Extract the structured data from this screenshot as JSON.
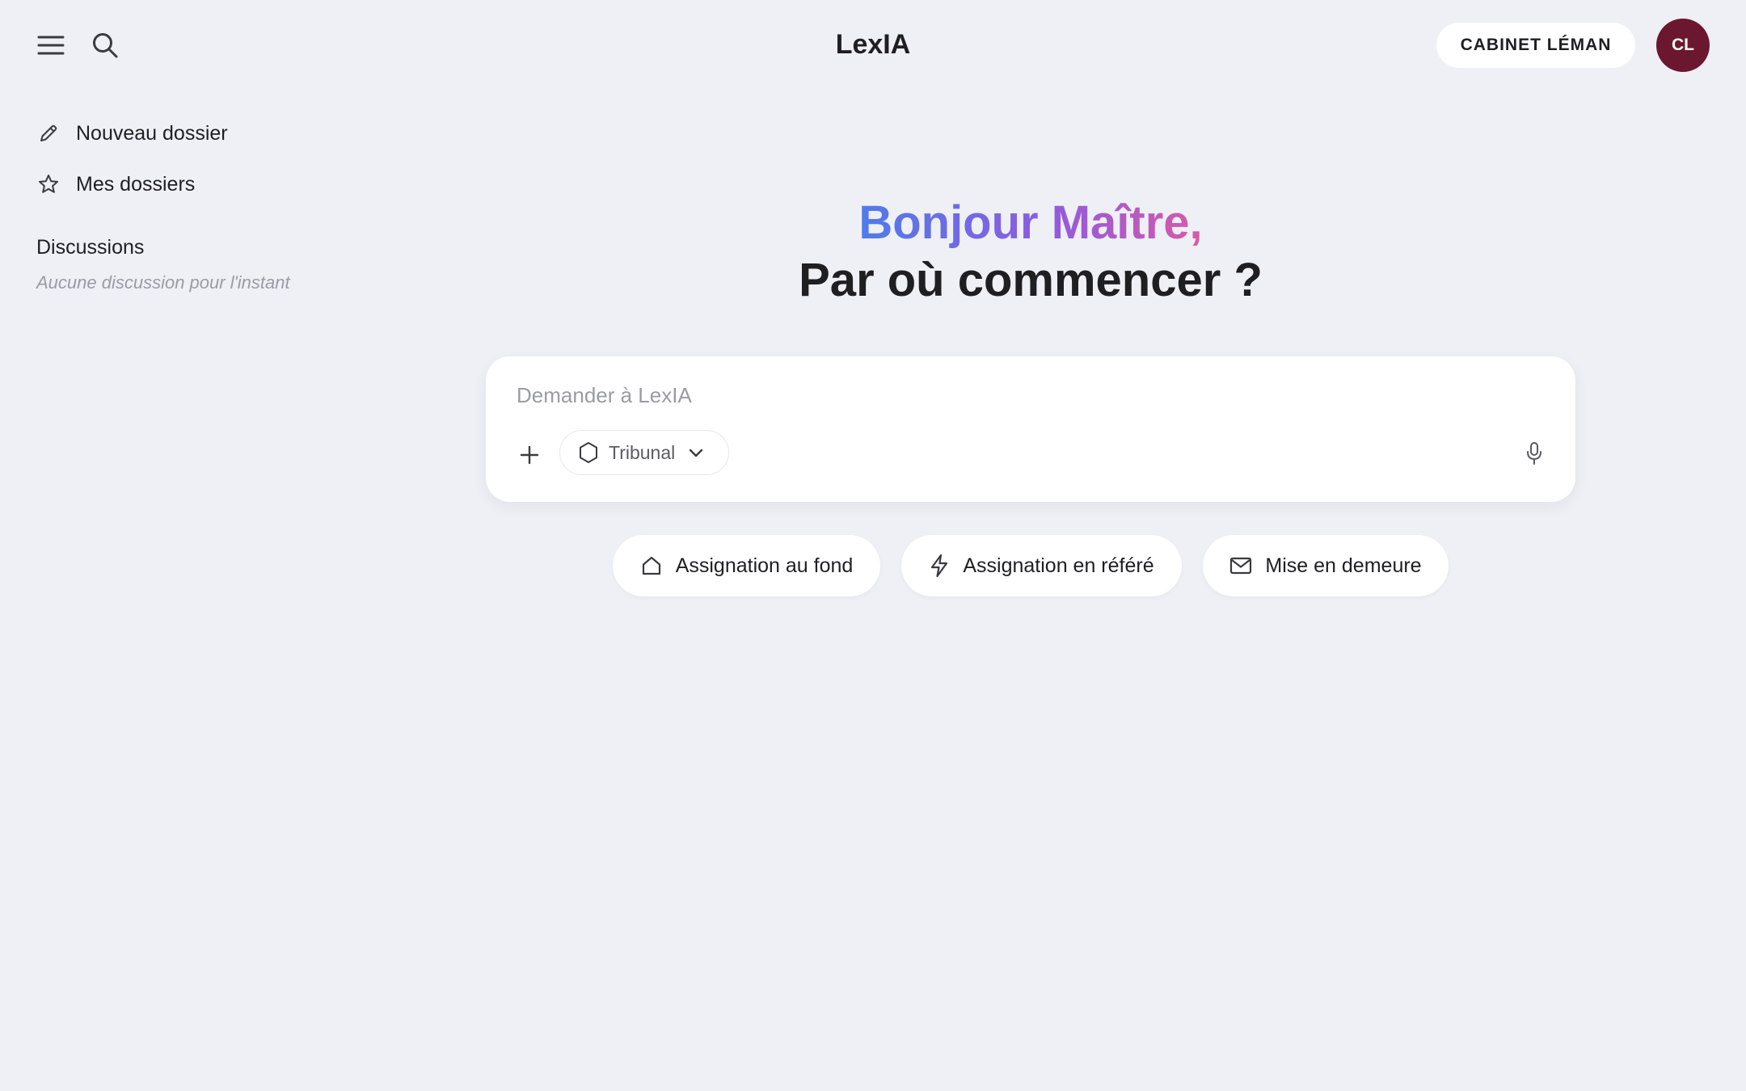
{
  "header": {
    "title": "LexIA",
    "menu_icon": "hamburger-menu-icon",
    "search_icon": "search-icon",
    "cabinet_label": "CABINET LÉMAN",
    "avatar_initials": "CL",
    "avatar_color": "#6b1730"
  },
  "sidebar": {
    "items": [
      {
        "label": "Nouveau dossier",
        "icon": "pencil-icon"
      },
      {
        "label": "Mes dossiers",
        "icon": "star-icon"
      }
    ],
    "discussions_title": "Discussions",
    "discussions_empty": "Aucune discussion pour l'instant"
  },
  "greeting": {
    "line1": "Bonjour Maître,",
    "line2": "Par où commencer ?",
    "gradient_colors": [
      "#4f7bea",
      "#8f5be0",
      "#d85aa8"
    ]
  },
  "composer": {
    "placeholder": "Demander à LexIA",
    "value": "",
    "add_icon": "plus-icon",
    "selector_label": "Tribunal",
    "selector_icon": "hexagon-icon",
    "mic_icon": "microphone-icon"
  },
  "suggestions": [
    {
      "label": "Assignation au fond",
      "icon": "home-icon"
    },
    {
      "label": "Assignation en référé",
      "icon": "lightning-icon"
    },
    {
      "label": "Mise en demeure",
      "icon": "mail-icon"
    }
  ],
  "colors": {
    "background": "#eef0f5",
    "surface": "#ffffff",
    "text": "#1f1f22",
    "muted": "#9a9ca3"
  }
}
